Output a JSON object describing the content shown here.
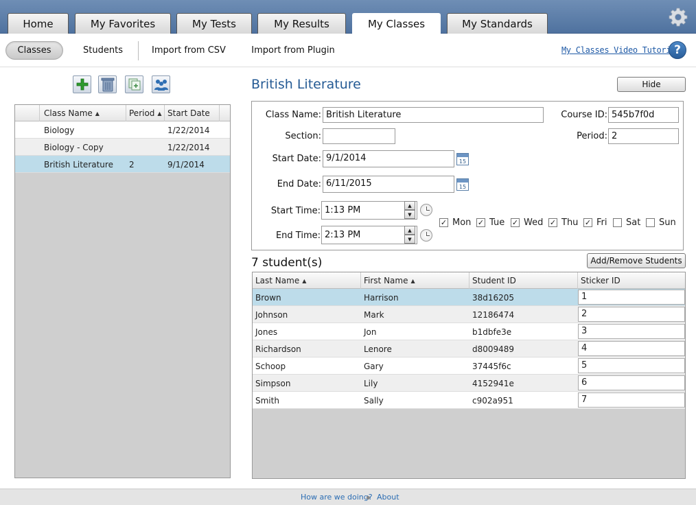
{
  "tabs": [
    {
      "label": "Home"
    },
    {
      "label": "My Favorites"
    },
    {
      "label": "My Tests"
    },
    {
      "label": "My Results"
    },
    {
      "label": "My Classes"
    },
    {
      "label": "My Standards"
    }
  ],
  "subnav": {
    "items": [
      {
        "label": "Classes"
      },
      {
        "label": "Students"
      },
      {
        "label": "Import from CSV"
      },
      {
        "label": "Import from Plugin"
      }
    ],
    "video_link": "My Classes Video Tutorial",
    "help": "?"
  },
  "class_grid": {
    "headers": [
      "Class Name",
      "Period",
      "Start Date"
    ],
    "rows": [
      {
        "name": "Biology",
        "period": "",
        "start": "1/22/2014"
      },
      {
        "name": "Biology - Copy",
        "period": "",
        "start": "1/22/2014"
      },
      {
        "name": "British Literature",
        "period": "2",
        "start": "9/1/2014"
      }
    ]
  },
  "detail": {
    "title": "British Literature",
    "hide_label": "Hide",
    "labels": {
      "class_name": "Class Name:",
      "course_id": "Course ID:",
      "section": "Section:",
      "period": "Period:",
      "start_date": "Start Date:",
      "end_date": "End Date:",
      "start_time": "Start Time:",
      "end_time": "End Time:"
    },
    "values": {
      "class_name": "British Literature",
      "course_id": "545b7f0d",
      "section": "",
      "period": "2",
      "start_date": "9/1/2014",
      "end_date": "6/11/2015",
      "start_time": "1:13 PM",
      "end_time": "2:13 PM"
    },
    "calendar_day": "15",
    "days": [
      {
        "label": "Mon",
        "checked": true
      },
      {
        "label": "Tue",
        "checked": true
      },
      {
        "label": "Wed",
        "checked": true
      },
      {
        "label": "Thu",
        "checked": true
      },
      {
        "label": "Fri",
        "checked": true
      },
      {
        "label": "Sat",
        "checked": false
      },
      {
        "label": "Sun",
        "checked": false
      }
    ]
  },
  "students": {
    "count_label": "7 student(s)",
    "add_remove_label": "Add/Remove Students",
    "headers": [
      "Last Name",
      "First Name",
      "Student ID",
      "Sticker ID"
    ],
    "rows": [
      {
        "last": "Brown",
        "first": "Harrison",
        "id": "38d16205",
        "sticker": "1"
      },
      {
        "last": "Johnson",
        "first": "Mark",
        "id": "12186474",
        "sticker": "2"
      },
      {
        "last": "Jones",
        "first": "Jon",
        "id": "b1dbfe3e",
        "sticker": "3"
      },
      {
        "last": "Richardson",
        "first": "Lenore",
        "id": "d8009489",
        "sticker": "4"
      },
      {
        "last": "Schoop",
        "first": "Gary",
        "id": "37445f6c",
        "sticker": "5"
      },
      {
        "last": "Simpson",
        "first": "Lily",
        "id": "4152941e",
        "sticker": "6"
      },
      {
        "last": "Smith",
        "first": "Sally",
        "id": "c902a951",
        "sticker": "7"
      }
    ]
  },
  "footer": {
    "feedback": "How are we doing?",
    "about": "About"
  },
  "colors": {
    "selected_row": "#bddcea",
    "title_blue": "#245a94",
    "tab_bar": "#5b7ca8"
  }
}
